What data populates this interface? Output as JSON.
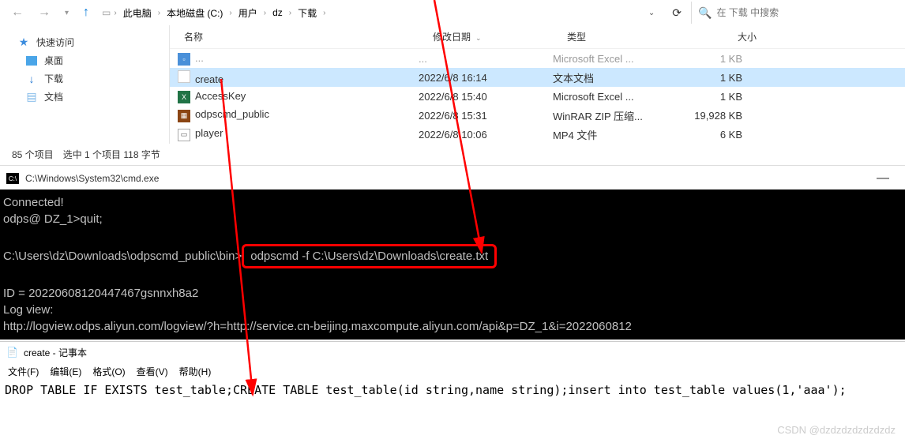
{
  "explorer": {
    "breadcrumb": [
      "此电脑",
      "本地磁盘 (C:)",
      "用户",
      "dz",
      "下载"
    ],
    "search_placeholder": "在 下载 中搜索",
    "sidebar": {
      "quick_access": "快速访问",
      "desktop": "桌面",
      "downloads": "下载",
      "documents": "文档"
    },
    "columns": {
      "name": "名称",
      "date": "修改日期",
      "type": "类型",
      "size": "大小"
    },
    "files": [
      {
        "name": "create",
        "date": "2022/6/8 16:14",
        "type": "文本文档",
        "size": "1 KB",
        "icon": "txt",
        "selected": true
      },
      {
        "name": "AccessKey",
        "date": "2022/6/8 15:40",
        "type": "Microsoft Excel ...",
        "size": "1 KB",
        "icon": "xls"
      },
      {
        "name": "odpscmd_public",
        "date": "2022/6/8 15:31",
        "type": "WinRAR ZIP 压缩...",
        "size": "19,928 KB",
        "icon": "zip"
      },
      {
        "name": "player",
        "date": "2022/6/8 10:06",
        "type": "MP4 文件",
        "size": "6 KB",
        "icon": "mp4"
      }
    ],
    "truncated_row": {
      "name": "...",
      "date": "...",
      "type": "Microsoft Excel ...",
      "size": "1 KB"
    },
    "status": {
      "items": "85 个项目",
      "selected": "选中 1 个项目 118 字节"
    }
  },
  "cmd": {
    "title": "C:\\Windows\\System32\\cmd.exe",
    "lines": {
      "l1": "Connected!",
      "l2": "odps@ DZ_1>quit;",
      "l3": " ",
      "l4a": "C:\\Users\\dz\\Downloads\\odpscmd_public\\bin>",
      "l4b": "odpscmd -f C:\\Users\\dz\\Downloads\\create.txt",
      "l5": " ",
      "l6": "ID = 20220608120447467gsnnxh8a2",
      "l7": "Log view:",
      "l8": "http://logview.odps.aliyun.com/logview/?h=http://service.cn-beijing.maxcompute.aliyun.com/api&p=DZ_1&i=2022060812"
    }
  },
  "notepad": {
    "title": "create - 记事本",
    "menu": [
      "文件(F)",
      "编辑(E)",
      "格式(O)",
      "查看(V)",
      "帮助(H)"
    ],
    "content": "DROP TABLE IF EXISTS test_table;CREATE TABLE test_table(id string,name string);insert into test_table values(1,'aaa');"
  },
  "watermark": "CSDN @dzdzdzdzdzdzdz"
}
